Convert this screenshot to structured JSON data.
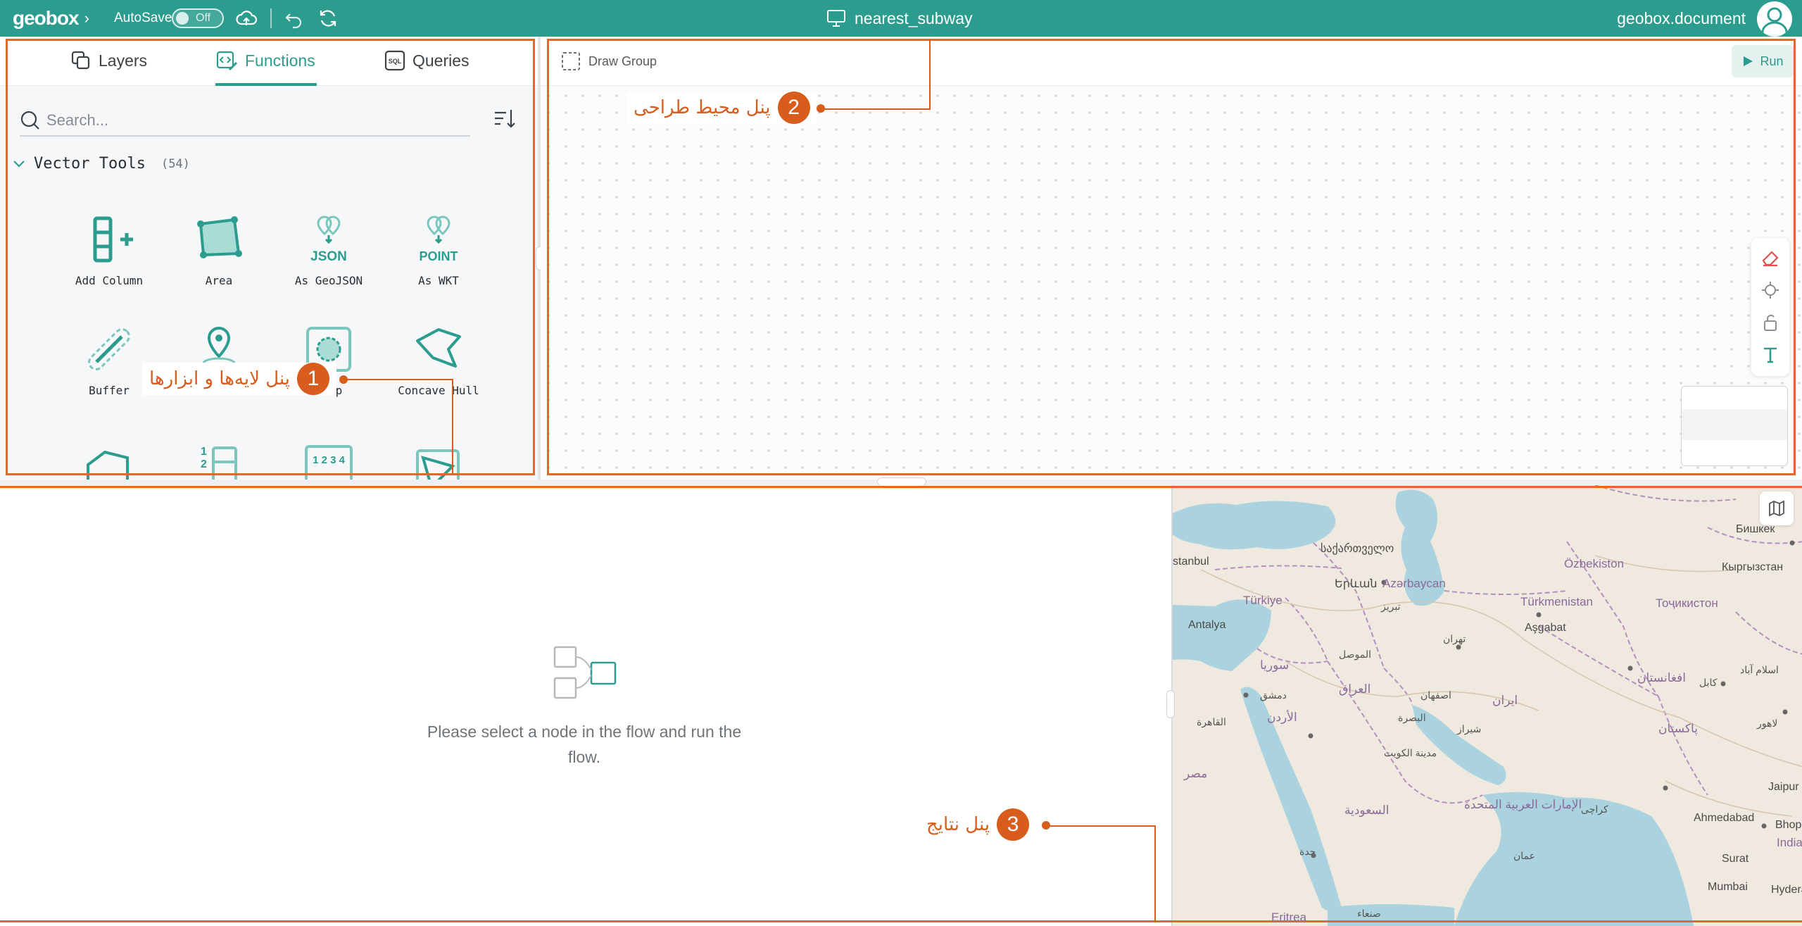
{
  "header": {
    "logo": "geobox",
    "autosave_label": "AutoSave",
    "autosave_state": "Off",
    "document_title": "nearest_subway",
    "user_name": "geobox.document"
  },
  "left_panel": {
    "tabs": [
      {
        "label": "Layers",
        "icon": "layers-icon"
      },
      {
        "label": "Functions",
        "icon": "functions-icon"
      },
      {
        "label": "Queries",
        "icon": "sql-icon"
      }
    ],
    "active_tab": "Functions",
    "search_placeholder": "Search...",
    "group": {
      "name": "Vector Tools",
      "count": "(54)"
    },
    "tools": [
      {
        "label": "Add Column",
        "icon": "add-column-icon"
      },
      {
        "label": "Area",
        "icon": "area-icon"
      },
      {
        "label": "As GeoJSON",
        "icon": "geojson-icon"
      },
      {
        "label": "As WKT",
        "icon": "wkt-icon"
      },
      {
        "label": "Buffer",
        "icon": "buffer-icon"
      },
      {
        "label": "Centroid",
        "icon": "centroid-icon"
      },
      {
        "label": "Clip",
        "icon": "clip-icon"
      },
      {
        "label": "Concave Hull",
        "icon": "concave-hull-icon"
      }
    ],
    "icon_text": {
      "json": "JSON",
      "point": "POINT",
      "nums": "1 2 3 4"
    }
  },
  "canvas": {
    "draw_group_label": "Draw Group",
    "run_label": "Run"
  },
  "results": {
    "empty_message": "Please select a node in the flow and run the flow."
  },
  "map": {
    "labels": [
      "Бишкек",
      "Özbekiston",
      "Кыргызстан",
      "stanbul",
      "საქართველო",
      "Türkiye",
      "Երևան",
      "Azərbaycan",
      "Türkmenistan",
      "Тоҷикистон",
      "Aşgabat",
      "تبریز",
      "Antalya",
      "تهران",
      "اسلام آباد",
      "سوريا",
      "الموصل",
      "افغانستان",
      "کابل",
      "دمشق",
      "العراق",
      "اصفهان",
      "ایران",
      "لاهور",
      "القاهرة",
      "الأردن",
      "البصرة",
      "شیراز",
      "پاکستان",
      "مدينة الكويت",
      "مصر",
      "الإمارات العربية المتحدة",
      "کراچی",
      "Jaipur",
      "السعودية",
      "Ahmedabad",
      "Bhop",
      "India",
      "جدة",
      "عمان",
      "Surat",
      "Mumbai",
      "Hyderab",
      "Eritrea",
      "صنعاء"
    ]
  },
  "annotations": {
    "panel1": {
      "number": "1",
      "text": "پنل لایه‌ها و ابزارها"
    },
    "panel2": {
      "number": "2",
      "text": "پنل محیط طراحی"
    },
    "panel3": {
      "number": "3",
      "text": "پنل نتایج"
    }
  },
  "colors": {
    "teal": "#2b9c8e",
    "annotation": "#d85d1c",
    "sea": "#aad3df",
    "land": "#efe9df"
  }
}
